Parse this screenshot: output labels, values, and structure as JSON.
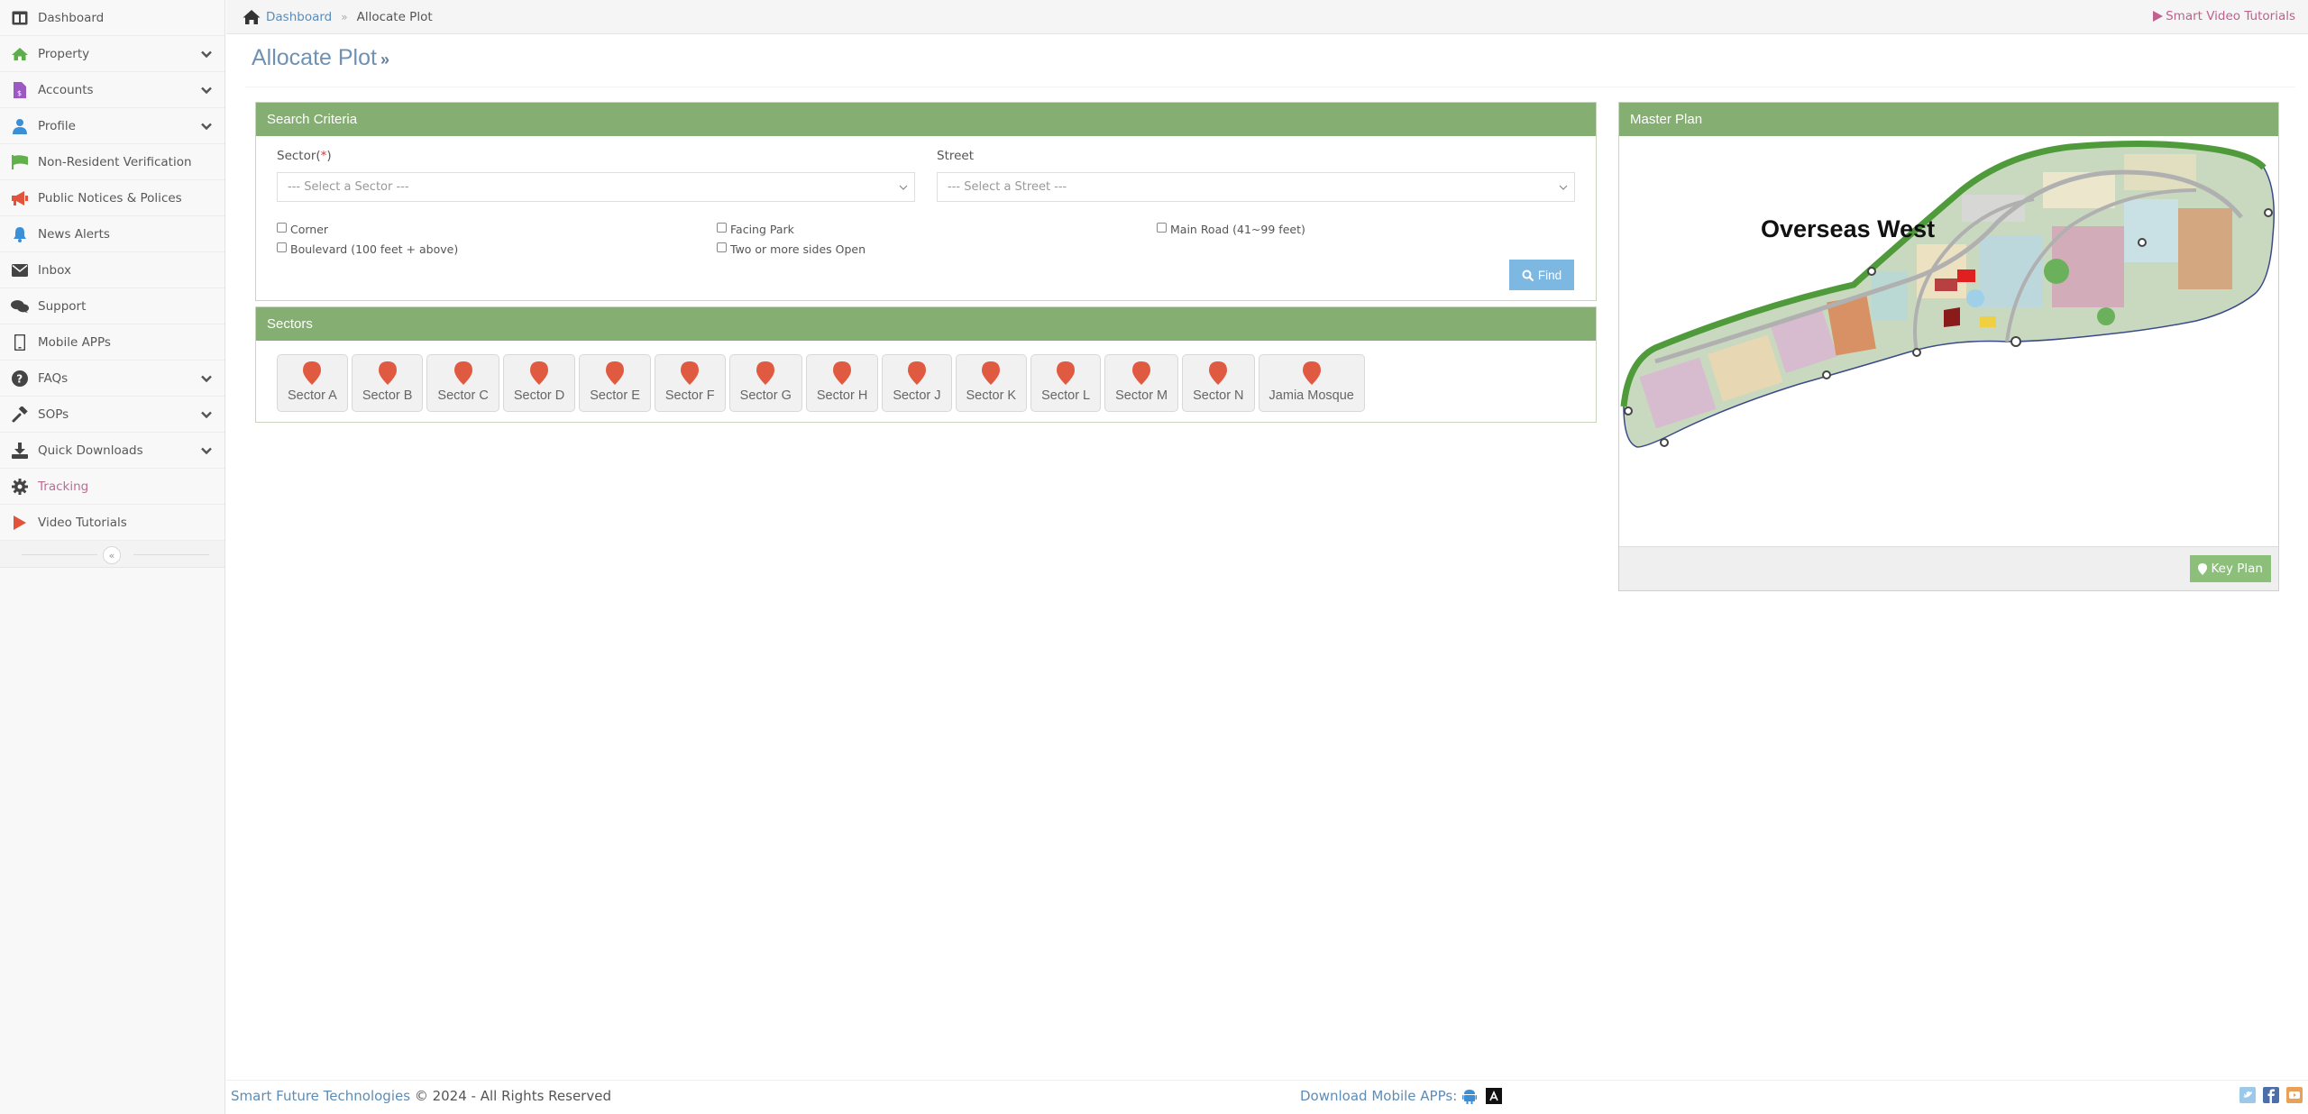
{
  "sidebar": {
    "items": [
      {
        "label": "Dashboard",
        "icon": "dashboard-icon",
        "expandable": false
      },
      {
        "label": "Property",
        "icon": "home-icon",
        "expandable": true
      },
      {
        "label": "Accounts",
        "icon": "invoice-icon",
        "expandable": true
      },
      {
        "label": "Profile",
        "icon": "user-icon",
        "expandable": true
      },
      {
        "label": "Non-Resident Verification",
        "icon": "flag-icon",
        "expandable": false
      },
      {
        "label": "Public Notices & Polices",
        "icon": "megaphone-icon",
        "expandable": false
      },
      {
        "label": "News Alerts",
        "icon": "bell-icon",
        "expandable": false
      },
      {
        "label": "Inbox",
        "icon": "envelope-icon",
        "expandable": false
      },
      {
        "label": "Support",
        "icon": "comments-icon",
        "expandable": false
      },
      {
        "label": "Mobile APPs",
        "icon": "mobile-icon",
        "expandable": false
      },
      {
        "label": "FAQs",
        "icon": "question-icon",
        "expandable": true
      },
      {
        "label": "SOPs",
        "icon": "gavel-icon",
        "expandable": true
      },
      {
        "label": "Quick Downloads",
        "icon": "download-icon",
        "expandable": true
      },
      {
        "label": "Tracking",
        "icon": "gear-icon",
        "expandable": false,
        "active": true
      },
      {
        "label": "Video Tutorials",
        "icon": "play-icon",
        "expandable": false
      }
    ],
    "collapse_glyph": "«"
  },
  "breadcrumb": {
    "home_link": "Dashboard",
    "separator": "»",
    "current": "Allocate Plot",
    "tutorials_link": "Smart Video Tutorials"
  },
  "page": {
    "title": "Allocate Plot",
    "title_suffix": "»"
  },
  "search": {
    "heading": "Search Criteria",
    "sector_label": "Sector(",
    "sector_required": "*",
    "sector_label_close": ")",
    "sector_placeholder": "--- Select a Sector ---",
    "street_label": "Street",
    "street_placeholder": "--- Select a Street ---",
    "checkboxes": [
      {
        "label": "Corner",
        "checked": false
      },
      {
        "label": "Boulevard (100 feet + above)",
        "checked": false
      },
      {
        "label": "Facing Park",
        "checked": false
      },
      {
        "label": "Two or more sides Open",
        "checked": false
      },
      {
        "label": "Main Road (41~99 feet)",
        "checked": false
      }
    ],
    "find_label": "Find"
  },
  "sectors": {
    "heading": "Sectors",
    "items": [
      "Sector A",
      "Sector B",
      "Sector C",
      "Sector D",
      "Sector E",
      "Sector F",
      "Sector G",
      "Sector H",
      "Sector J",
      "Sector K",
      "Sector L",
      "Sector M",
      "Sector N",
      "Jamia Mosque"
    ]
  },
  "master_plan": {
    "heading": "Master Plan",
    "map_title": "Overseas West",
    "key_plan_label": "Key Plan"
  },
  "footer": {
    "brand": "Smart Future Technologies",
    "copyright": " © 2024 - All Rights Reserved",
    "download_label": "Download Mobile APPs:",
    "apps": [
      "android-icon",
      "app-store-icon"
    ],
    "social": [
      "twitter-icon",
      "facebook-icon",
      "youtube-icon"
    ]
  },
  "colors": {
    "panel_header": "#85ae72",
    "link": "#5b8db8",
    "accent_pink": "#c0608f",
    "pin": "#e05a42",
    "find_button": "#7cb8e2",
    "key_plan_button": "#8cbf7a"
  }
}
